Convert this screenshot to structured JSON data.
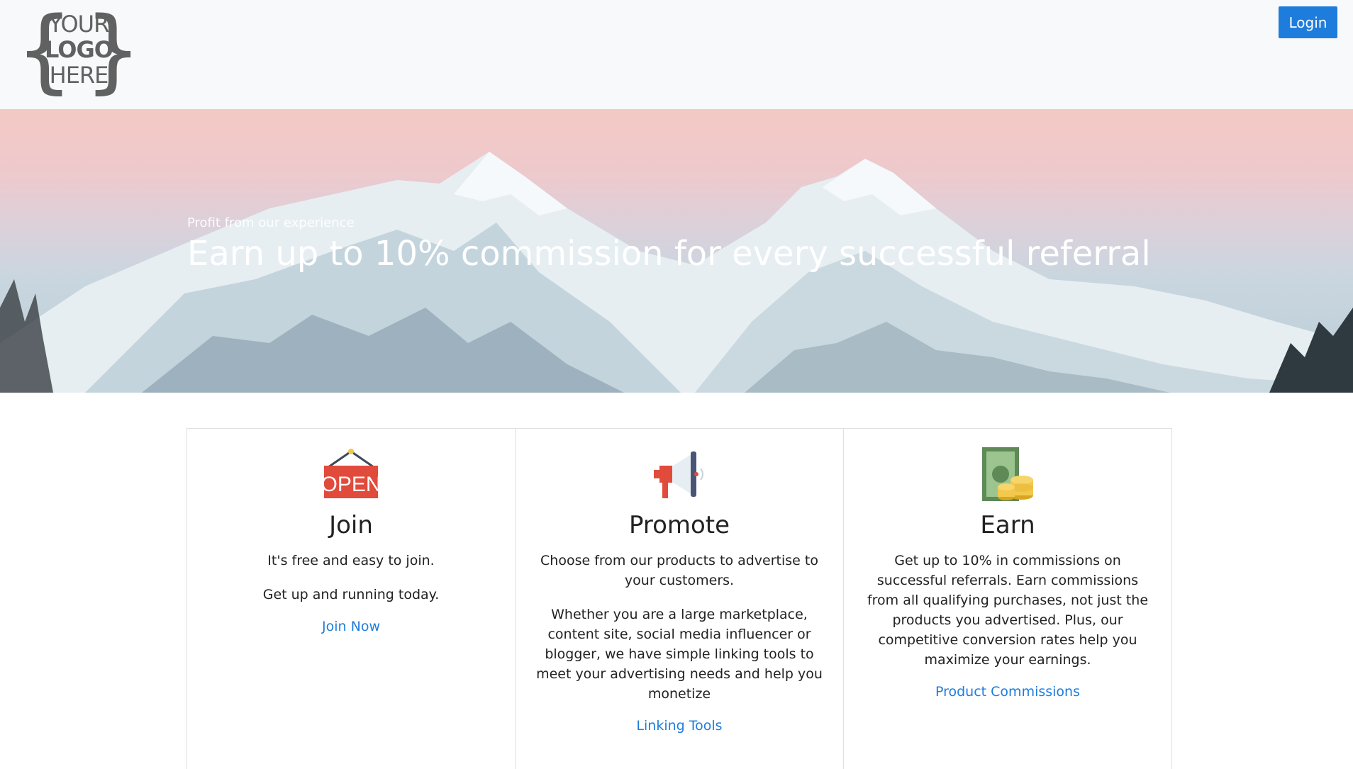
{
  "header": {
    "logo": {
      "line1": "YOUR",
      "line2": "LOGO",
      "line3": "HERE"
    },
    "login_label": "Login",
    "accent": "#1e7ddc"
  },
  "hero": {
    "kicker": "Profit from our experience",
    "headline": "Earn up to 10% commission for every successful referral"
  },
  "cards": [
    {
      "icon": "open-sign-icon",
      "title": "Join",
      "paragraphs": [
        "It's free and easy to join.",
        "Get up and running today."
      ],
      "link": "Join Now"
    },
    {
      "icon": "megaphone-icon",
      "title": "Promote",
      "paragraphs": [
        "Choose from our products to advertise to your customers.",
        "Whether you are a large marketplace, content site, social media influencer or blogger, we have simple linking tools to meet your advertising needs and help you monetize"
      ],
      "link": "Linking Tools"
    },
    {
      "icon": "money-coins-icon",
      "title": "Earn",
      "paragraphs": [
        "Get up to 10% in commissions on successful referrals. Earn commissions from all qualifying purchases, not just the products you advertised. Plus, our competitive conversion rates help you maximize your earnings."
      ],
      "link": "Product Commissions"
    }
  ]
}
